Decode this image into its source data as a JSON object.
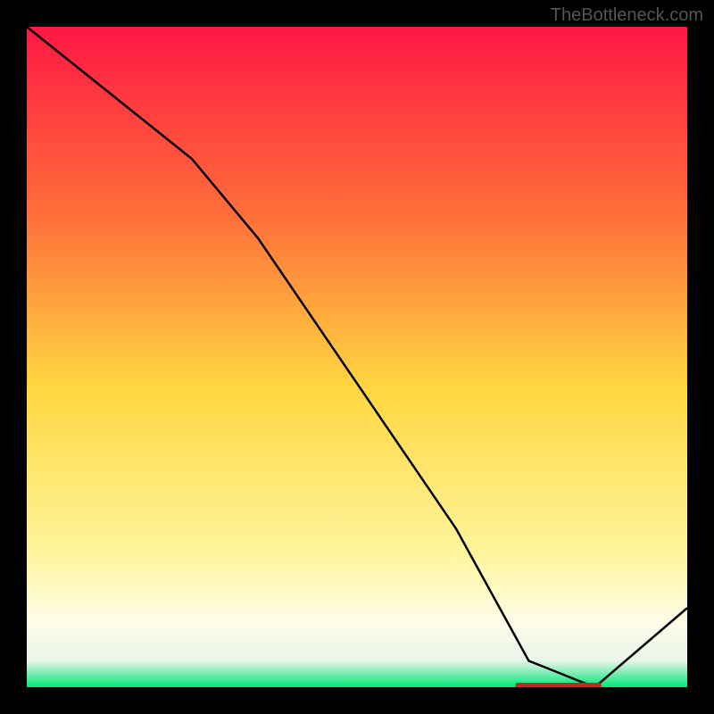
{
  "watermark": "TheBottleneck.com",
  "chart_data": {
    "type": "line",
    "title": "",
    "xlabel": "",
    "ylabel": "",
    "x": [
      0.0,
      0.25,
      0.35,
      0.5,
      0.65,
      0.76,
      0.86,
      1.0
    ],
    "values": [
      1.0,
      0.8,
      0.68,
      0.46,
      0.24,
      0.04,
      0.0,
      0.12
    ],
    "xlim": [
      0,
      1
    ],
    "ylim": [
      0,
      1
    ],
    "background_gradient": [
      {
        "stop": 0.0,
        "color": "#ff1744"
      },
      {
        "stop": 0.28,
        "color": "#ff6d3a"
      },
      {
        "stop": 0.55,
        "color": "#ffd740"
      },
      {
        "stop": 0.8,
        "color": "#fff59d"
      },
      {
        "stop": 0.9,
        "color": "#fffde7"
      },
      {
        "stop": 0.96,
        "color": "#e8f5e9"
      },
      {
        "stop": 1.0,
        "color": "#00e676"
      }
    ],
    "marker": {
      "x_range": [
        0.74,
        0.87
      ],
      "y": 0.0,
      "label": ""
    }
  }
}
